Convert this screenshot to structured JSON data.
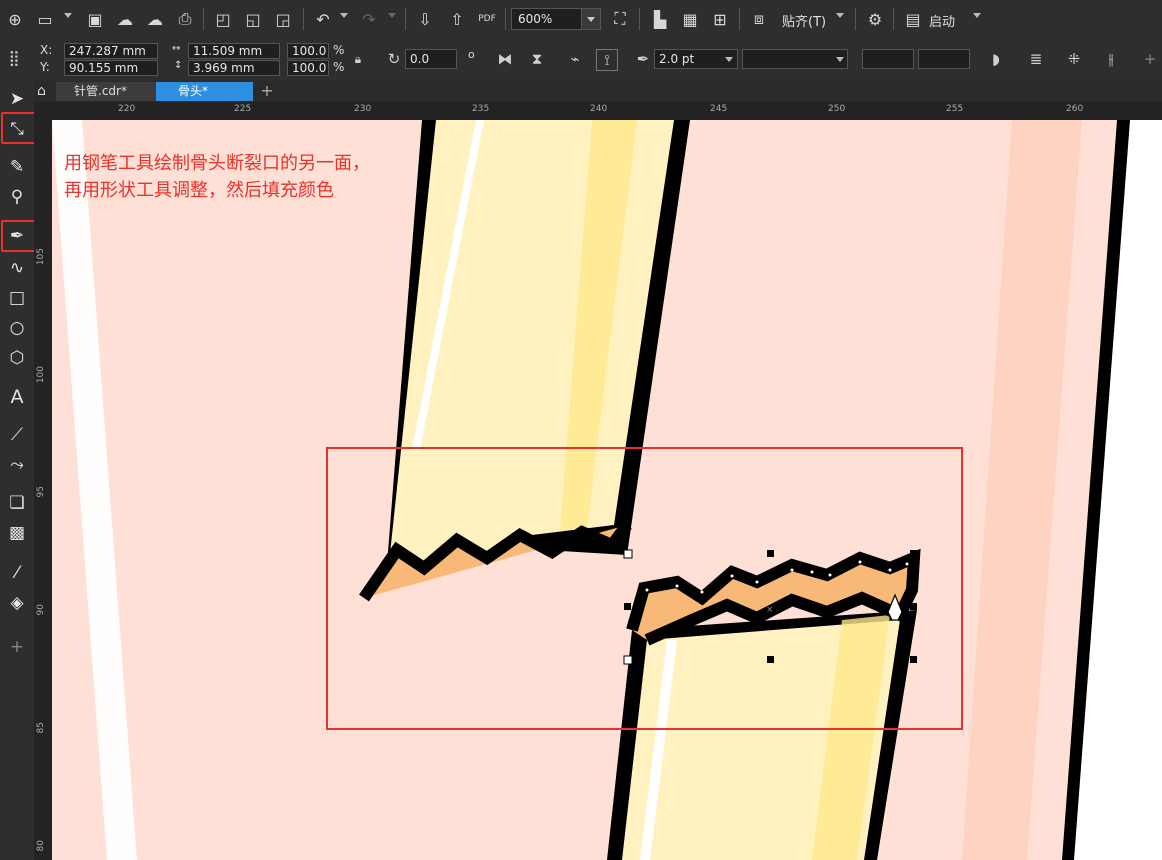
{
  "toolbar": {
    "zoom_value": "600%",
    "snap_label": "贴齐(T)",
    "launch_label": "启动",
    "pdf_label": "PDF"
  },
  "property_bar": {
    "x_label": "X:",
    "y_label": "Y:",
    "x_value": "247.287 mm",
    "y_value": "90.155 mm",
    "width_value": "11.509 mm",
    "height_value": "3.969 mm",
    "scale_x": "100.0",
    "scale_y": "100.0",
    "percent": "%",
    "rotation_value": "0.0",
    "degree_symbol": "o",
    "outline_width": "2.0 pt"
  },
  "tabs": [
    {
      "label": "针管.cdr*",
      "active": false
    },
    {
      "label": "骨头*",
      "active": true
    }
  ],
  "rulers": {
    "horizontal": [
      "220",
      "225",
      "230",
      "235",
      "240",
      "245",
      "250",
      "255",
      "260"
    ],
    "vertical": [
      "105",
      "100",
      "95",
      "90",
      "85",
      "80"
    ]
  },
  "annotation": {
    "line1": "用钢笔工具绘制骨头断裂口的另一面，",
    "line2": "再用形状工具调整，然后填充颜色"
  },
  "colors": {
    "accent_red": "#e8322b",
    "tab_active": "#2e8fe0",
    "bone_fill": "#fff2c0",
    "bone_shade": "#ffe88a",
    "skin_fill": "#ffe0d6",
    "inner_fill": "#f7b878"
  },
  "icons": {
    "pick": "pick-tool-icon",
    "shape": "shape-tool-icon",
    "pen": "pen-tool-icon",
    "fill": "fill-tool-icon"
  }
}
